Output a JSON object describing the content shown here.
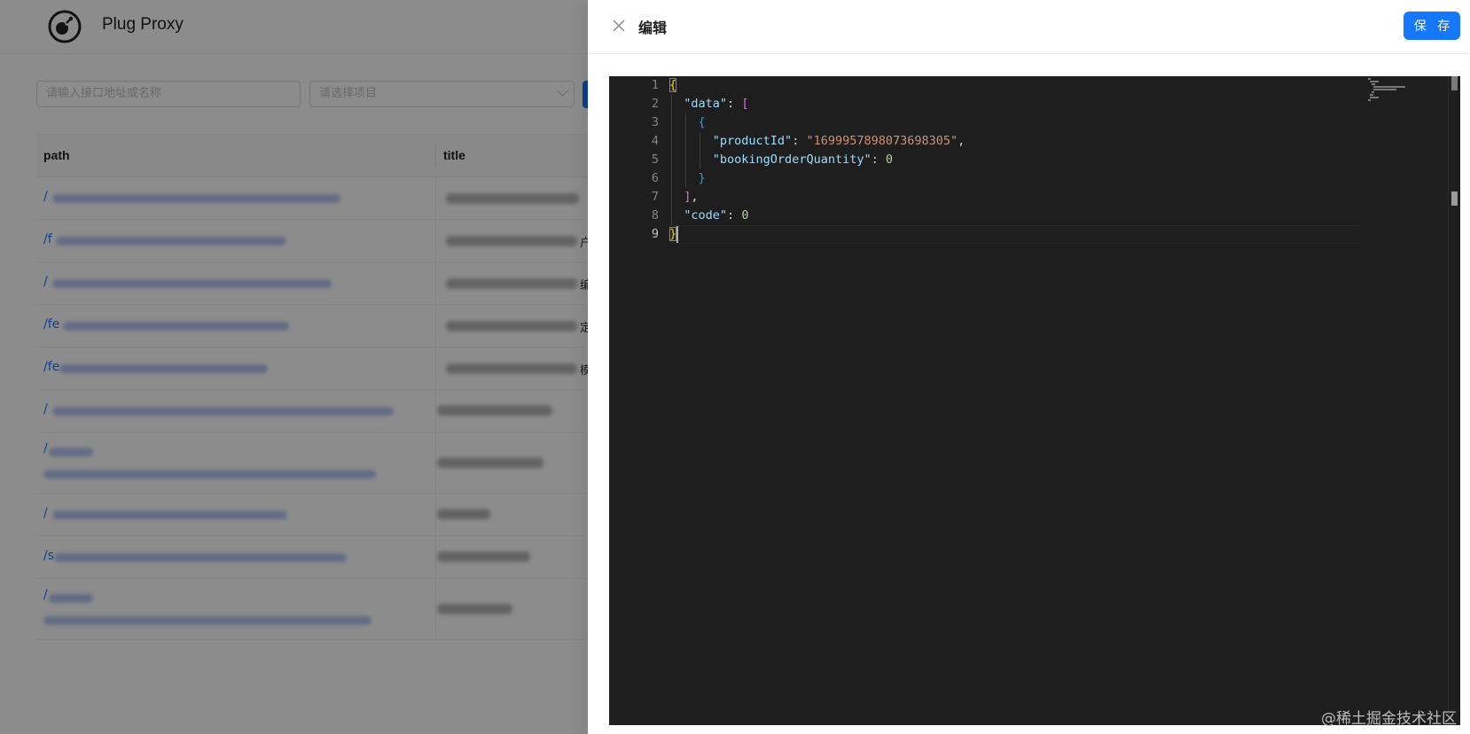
{
  "app": {
    "title": "Plug Proxy"
  },
  "filters": {
    "search_placeholder": "请输入接口地址或名称",
    "project_placeholder": "请选择项目"
  },
  "table": {
    "columns": [
      "path",
      "title"
    ],
    "rows": [
      {
        "path_prefix": "/",
        "tail": ""
      },
      {
        "path_prefix": "/f",
        "tail": "户"
      },
      {
        "path_prefix": "/",
        "tail": "编"
      },
      {
        "path_prefix": "/fe",
        "tail": "定"
      },
      {
        "path_prefix": "/fe",
        "tail": "模"
      },
      {
        "path_prefix": "/",
        "tail": ""
      },
      {
        "path_prefix": "/",
        "tail": ""
      },
      {
        "path_prefix": "/",
        "tail": ""
      },
      {
        "path_prefix": "/s",
        "tail": ""
      },
      {
        "path_prefix": "/",
        "tail": ""
      }
    ]
  },
  "drawer": {
    "title": "编辑",
    "save_label": "保 存"
  },
  "editor": {
    "line_numbers": [
      "1",
      "2",
      "3",
      "4",
      "5",
      "6",
      "7",
      "8",
      "9"
    ],
    "active_line": 9,
    "lines": [
      [
        {
          "t": "{",
          "c": "tok-b1"
        }
      ],
      [
        {
          "t": "  "
        },
        {
          "t": "\"data\"",
          "c": "tok-key"
        },
        {
          "t": ": "
        },
        {
          "t": "[",
          "c": "tok-b2"
        }
      ],
      [
        {
          "t": "    "
        },
        {
          "t": "{",
          "c": "tok-b3"
        }
      ],
      [
        {
          "t": "      "
        },
        {
          "t": "\"productId\"",
          "c": "tok-key"
        },
        {
          "t": ": "
        },
        {
          "t": "\"1699957898073698305\"",
          "c": "tok-str"
        },
        {
          "t": ","
        }
      ],
      [
        {
          "t": "      "
        },
        {
          "t": "\"bookingOrderQuantity\"",
          "c": "tok-key"
        },
        {
          "t": ": "
        },
        {
          "t": "0",
          "c": "tok-num"
        }
      ],
      [
        {
          "t": "    "
        },
        {
          "t": "}",
          "c": "tok-b3"
        }
      ],
      [
        {
          "t": "  "
        },
        {
          "t": "]",
          "c": "tok-b2"
        },
        {
          "t": ","
        }
      ],
      [
        {
          "t": "  "
        },
        {
          "t": "\"code\"",
          "c": "tok-key"
        },
        {
          "t": ": "
        },
        {
          "t": "0",
          "c": "tok-num"
        }
      ],
      [
        {
          "t": "}",
          "c": "tok-b1"
        }
      ]
    ]
  },
  "watermark": "@稀土掘金技术社区",
  "colors": {
    "primary": "#1677ff",
    "editor_bg": "#1e1e1e",
    "key": "#9cdcfe",
    "string": "#ce9178",
    "number": "#b5cea8"
  }
}
